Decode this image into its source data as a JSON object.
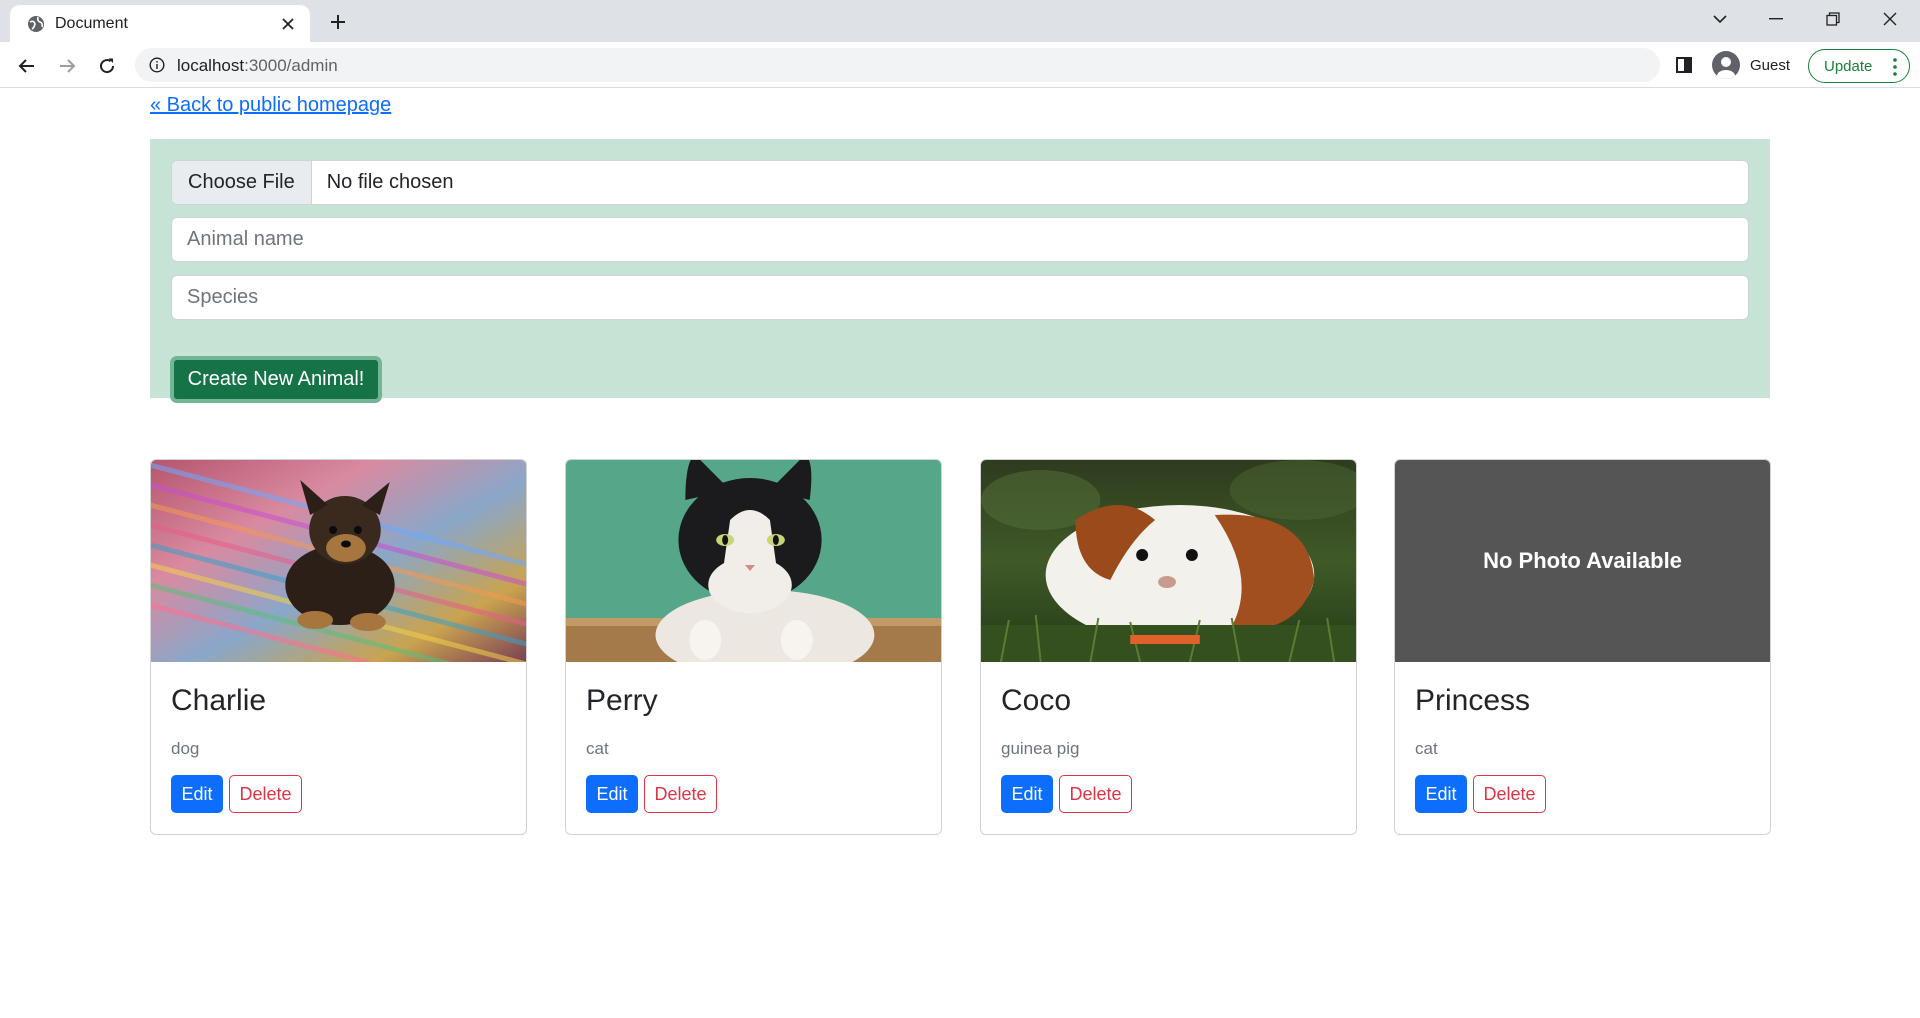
{
  "browser": {
    "tab_title": "Document",
    "url_host": "localhost",
    "url_rest": ":3000/admin",
    "profile_label": "Guest",
    "update_label": "Update"
  },
  "page": {
    "back_link": "« Back to public homepage"
  },
  "form": {
    "choose_file_label": "Choose File",
    "file_status": "No file chosen",
    "name_placeholder": "Animal name",
    "species_placeholder": "Species",
    "submit_label": "Create New Animal!"
  },
  "animals": [
    {
      "name": "Charlie",
      "species": "dog",
      "photo": "puppy-photo",
      "edit_label": "Edit",
      "delete_label": "Delete"
    },
    {
      "name": "Perry",
      "species": "cat",
      "photo": "cat-photo",
      "edit_label": "Edit",
      "delete_label": "Delete"
    },
    {
      "name": "Coco",
      "species": "guinea pig",
      "photo": "guinea-pig-photo",
      "edit_label": "Edit",
      "delete_label": "Delete"
    },
    {
      "name": "Princess",
      "species": "cat",
      "photo_placeholder": "No Photo Available",
      "edit_label": "Edit",
      "delete_label": "Delete"
    }
  ],
  "colors": {
    "form_bg": "#c7e3d6",
    "primary": "#0d6efd",
    "success": "#157347",
    "danger": "#dc3545"
  }
}
